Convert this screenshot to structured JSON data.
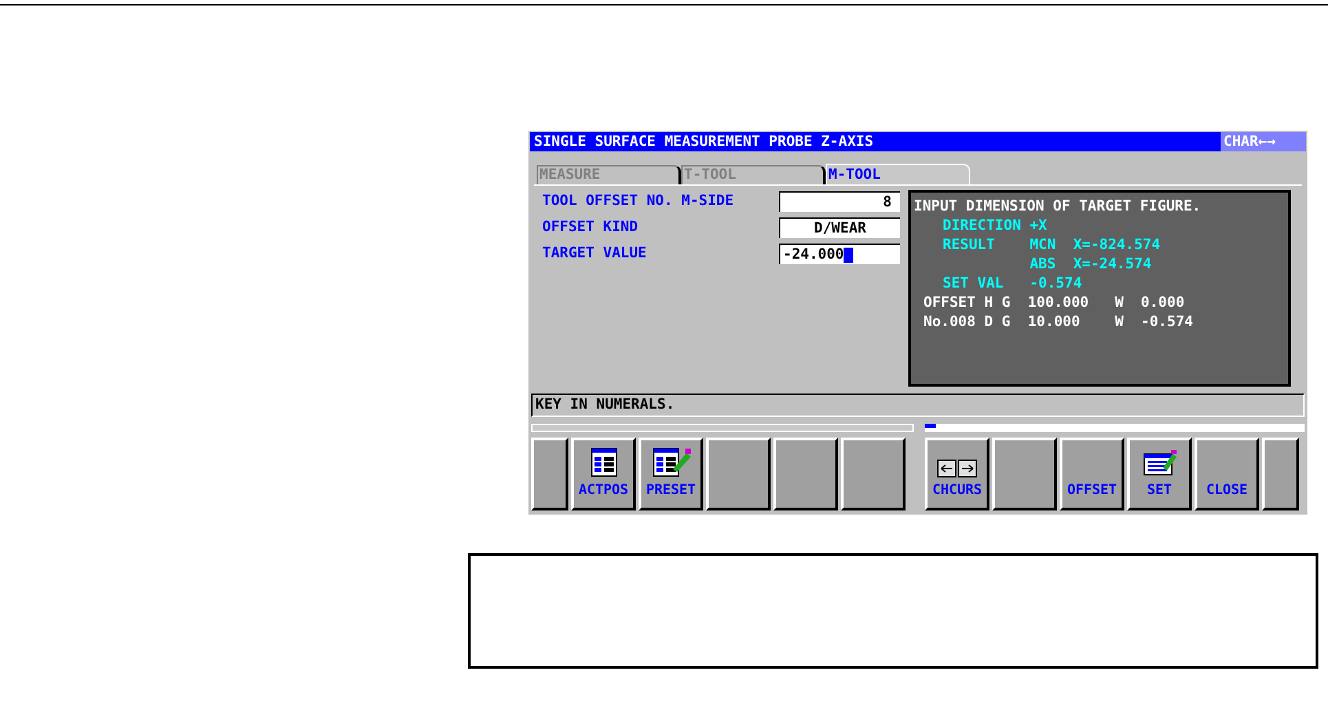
{
  "window": {
    "title": "SINGLE SURFACE MEASUREMENT PROBE Z-AXIS",
    "input_mode": "CHAR←→"
  },
  "tabs": [
    {
      "label": "MEASURE",
      "selected": false
    },
    {
      "label": "T-TOOL",
      "selected": false
    },
    {
      "label": "M-TOOL",
      "selected": true
    }
  ],
  "fields": [
    {
      "label": "TOOL OFFSET NO. M-SIDE",
      "value": "8",
      "kind": "number",
      "cursor": false
    },
    {
      "label": "OFFSET KIND",
      "value": "D/WEAR",
      "kind": "choice",
      "cursor": false
    },
    {
      "label": "TARGET VALUE",
      "value": "-24.000",
      "kind": "input",
      "cursor": true
    }
  ],
  "info_lines": [
    {
      "kind": "message",
      "text": "INPUT DIMENSION OF TARGET FIGURE."
    },
    {
      "kind": "result",
      "text": "DIRECTION +X"
    },
    {
      "kind": "result",
      "text": "RESULT    MCN  X=-824.574"
    },
    {
      "kind": "result",
      "text": "          ABS  X=-24.574"
    },
    {
      "kind": "result",
      "text": "SET VAL   -0.574"
    },
    {
      "kind": "offset",
      "text": "OFFSET H G  100.000   W  0.000"
    },
    {
      "kind": "offset",
      "text": "No.008 D G  10.000    W  -0.574"
    }
  ],
  "message": "KEY IN NUMERALS.",
  "softkeys_left": [
    {
      "kind": "end"
    },
    {
      "kind": "axes",
      "label": "ACTPOS"
    },
    {
      "kind": "axes-pen",
      "label": "PRESET"
    },
    {
      "kind": "key"
    },
    {
      "kind": "key"
    },
    {
      "kind": "key"
    }
  ],
  "softkeys_right": [
    {
      "kind": "arrows",
      "label": "CHCURS"
    },
    {
      "kind": "key"
    },
    {
      "kind": "key",
      "label": "OFFSET"
    },
    {
      "kind": "table-pen",
      "label": "SET"
    },
    {
      "kind": "key",
      "label": "CLOSE"
    },
    {
      "kind": "end"
    }
  ]
}
